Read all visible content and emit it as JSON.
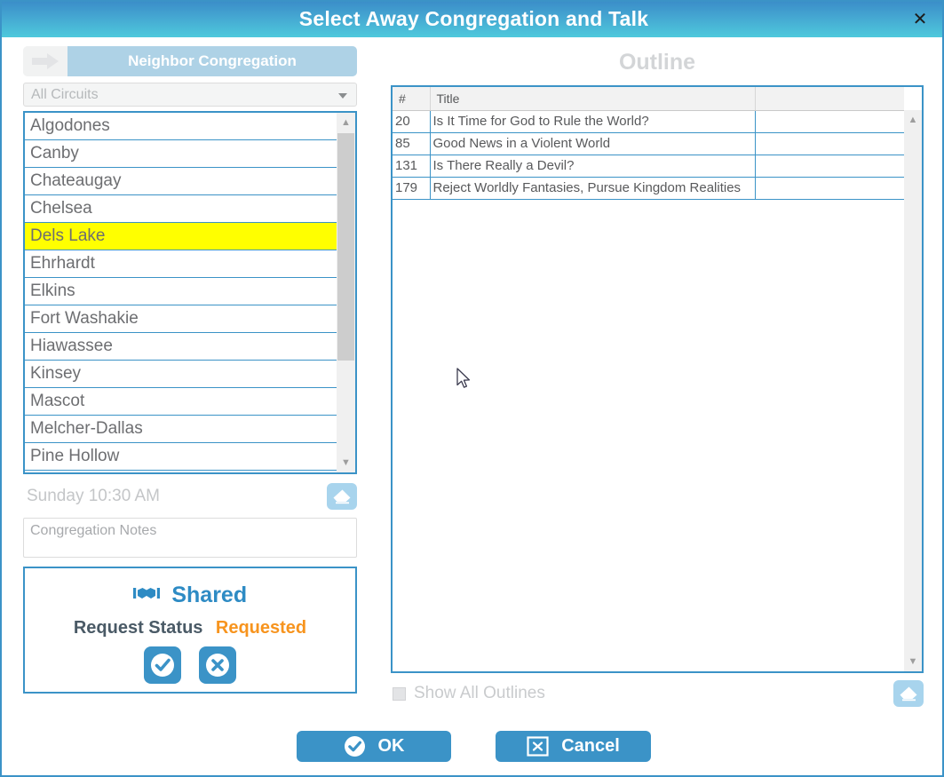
{
  "window": {
    "title": "Select Away Congregation and Talk",
    "close_icon": "close-icon"
  },
  "left_panel": {
    "tab": {
      "label": "Neighbor Congregation",
      "icon": "arrow-right-icon"
    },
    "circuit_filter": {
      "value": "All Circuits",
      "caret_icon": "chevron-down-icon"
    },
    "congregations": [
      {
        "name": "Algodones",
        "selected": false
      },
      {
        "name": "Canby",
        "selected": false
      },
      {
        "name": "Chateaugay",
        "selected": false
      },
      {
        "name": "Chelsea",
        "selected": false
      },
      {
        "name": "Dels Lake",
        "selected": true
      },
      {
        "name": "Ehrhardt",
        "selected": false
      },
      {
        "name": "Elkins",
        "selected": false
      },
      {
        "name": "Fort Washakie",
        "selected": false
      },
      {
        "name": "Hiawassee",
        "selected": false
      },
      {
        "name": "Kinsey",
        "selected": false
      },
      {
        "name": "Mascot",
        "selected": false
      },
      {
        "name": "Melcher-Dallas",
        "selected": false
      },
      {
        "name": "Pine Hollow",
        "selected": false
      }
    ],
    "meeting_time": "Sunday 10:30 AM",
    "clear_time_icon": "eraser-icon",
    "notes_placeholder": "Congregation Notes",
    "notes_value": "",
    "shared": {
      "icon": "handshake-icon",
      "title": "Shared",
      "status_label": "Request Status",
      "status_value": "Requested",
      "accept_icon": "check-circle-icon",
      "decline_icon": "x-circle-icon"
    }
  },
  "right_panel": {
    "heading": "Outline",
    "columns": [
      "#",
      "Title",
      ""
    ],
    "rows": [
      {
        "number": "20",
        "title": "Is It Time for God to Rule the World?",
        "extra": ""
      },
      {
        "number": "85",
        "title": "Good News in a Violent World",
        "extra": ""
      },
      {
        "number": "131",
        "title": "Is There Really a Devil?",
        "extra": ""
      },
      {
        "number": "179",
        "title": "Reject Worldly Fantasies, Pursue Kingdom Realities",
        "extra": ""
      }
    ],
    "show_all_outlines": {
      "label": "Show All Outlines",
      "checked": false
    },
    "clear_outline_icon": "eraser-icon"
  },
  "footer": {
    "ok_label": "OK",
    "ok_icon": "check-circle-icon",
    "cancel_label": "Cancel",
    "cancel_icon": "x-square-icon"
  },
  "colors": {
    "accent_blue": "#3b93c7",
    "title_gradient_top": "#3b8ec9",
    "title_gradient_bottom": "#4ec9dc",
    "tab_blue": "#aed2e6",
    "selection_yellow": "#ffff00",
    "status_orange": "#f7941e",
    "muted_gray": "#c4c6c8",
    "text_gray": "#6d6e71"
  }
}
